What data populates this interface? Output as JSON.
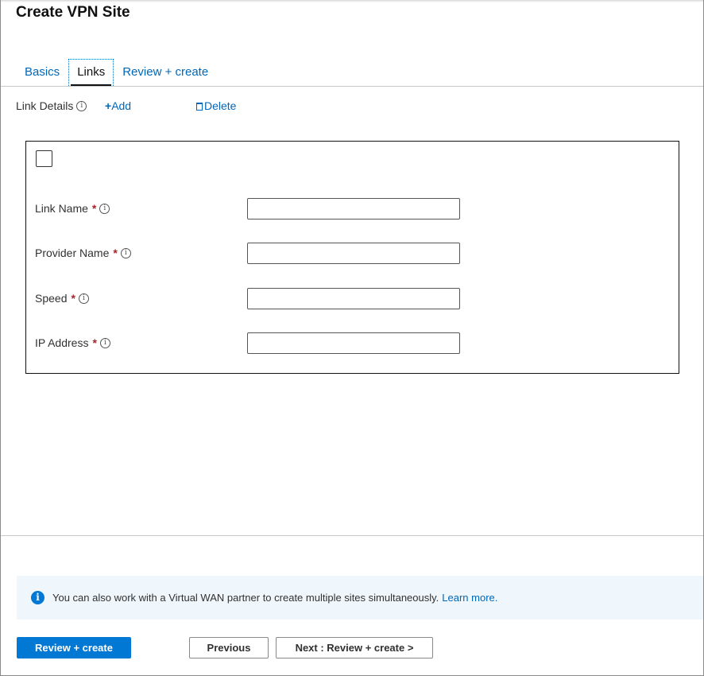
{
  "page": {
    "title": "Create VPN Site"
  },
  "tabs": [
    {
      "label": "Basics",
      "active": false
    },
    {
      "label": "Links",
      "active": true
    },
    {
      "label": "Review + create",
      "active": false
    }
  ],
  "toolbar": {
    "link_details_label": "Link Details",
    "add_label": "Add",
    "delete_label": "Delete"
  },
  "link_form": {
    "selected": false,
    "fields": [
      {
        "label": "Link Name",
        "required_mark": "*",
        "value": ""
      },
      {
        "label": "Provider Name",
        "required_mark": "*",
        "value": ""
      },
      {
        "label": "Speed",
        "required_mark": "*",
        "value": ""
      },
      {
        "label": "IP Address",
        "required_mark": "*",
        "value": ""
      }
    ]
  },
  "banner": {
    "text": "You can also work with a Virtual WAN partner to create multiple sites simultaneously.",
    "link": "Learn more."
  },
  "footer": {
    "review_create_label": "Review + create",
    "previous_label": "Previous",
    "next_label": "Next : Review + create >"
  },
  "colors": {
    "accent": "#0078d4",
    "link": "#0067b8",
    "required": "#a4262c",
    "banner_bg": "#eff6fc"
  }
}
